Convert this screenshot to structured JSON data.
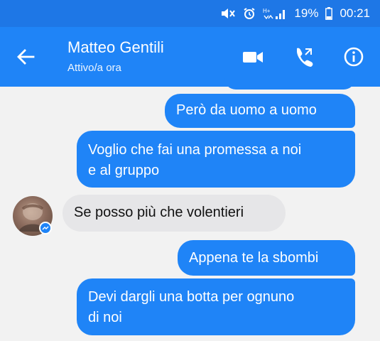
{
  "status_bar": {
    "battery_percent": "19%",
    "time": "00:21"
  },
  "header": {
    "contact_name": "Matteo Gentili",
    "contact_status": "Attivo/a ora"
  },
  "messages": [
    {
      "direction": "outgoing",
      "text": "Però da uomo a uomo"
    },
    {
      "direction": "outgoing",
      "line1": "Voglio che fai una promessa a noi",
      "line2": "e al gruppo"
    },
    {
      "direction": "incoming",
      "text": "Se posso più che volentieri"
    },
    {
      "direction": "outgoing",
      "text": "Appena te la sbombi"
    },
    {
      "direction": "outgoing",
      "line1": "Devi dargli una botta per ognuno",
      "line2": "di noi"
    }
  ],
  "colors": {
    "status_bar": "#1e77e6",
    "app_bar": "#1f84f7",
    "outgoing_bubble": "#1f84f7",
    "incoming_bubble": "#e6e6e8",
    "background": "#f2f2f2"
  },
  "icons": [
    "mute-icon",
    "alarm-icon",
    "signal-icon",
    "battery-icon",
    "back-arrow-icon",
    "video-call-icon",
    "phone-call-icon",
    "info-icon",
    "messenger-badge-icon"
  ]
}
